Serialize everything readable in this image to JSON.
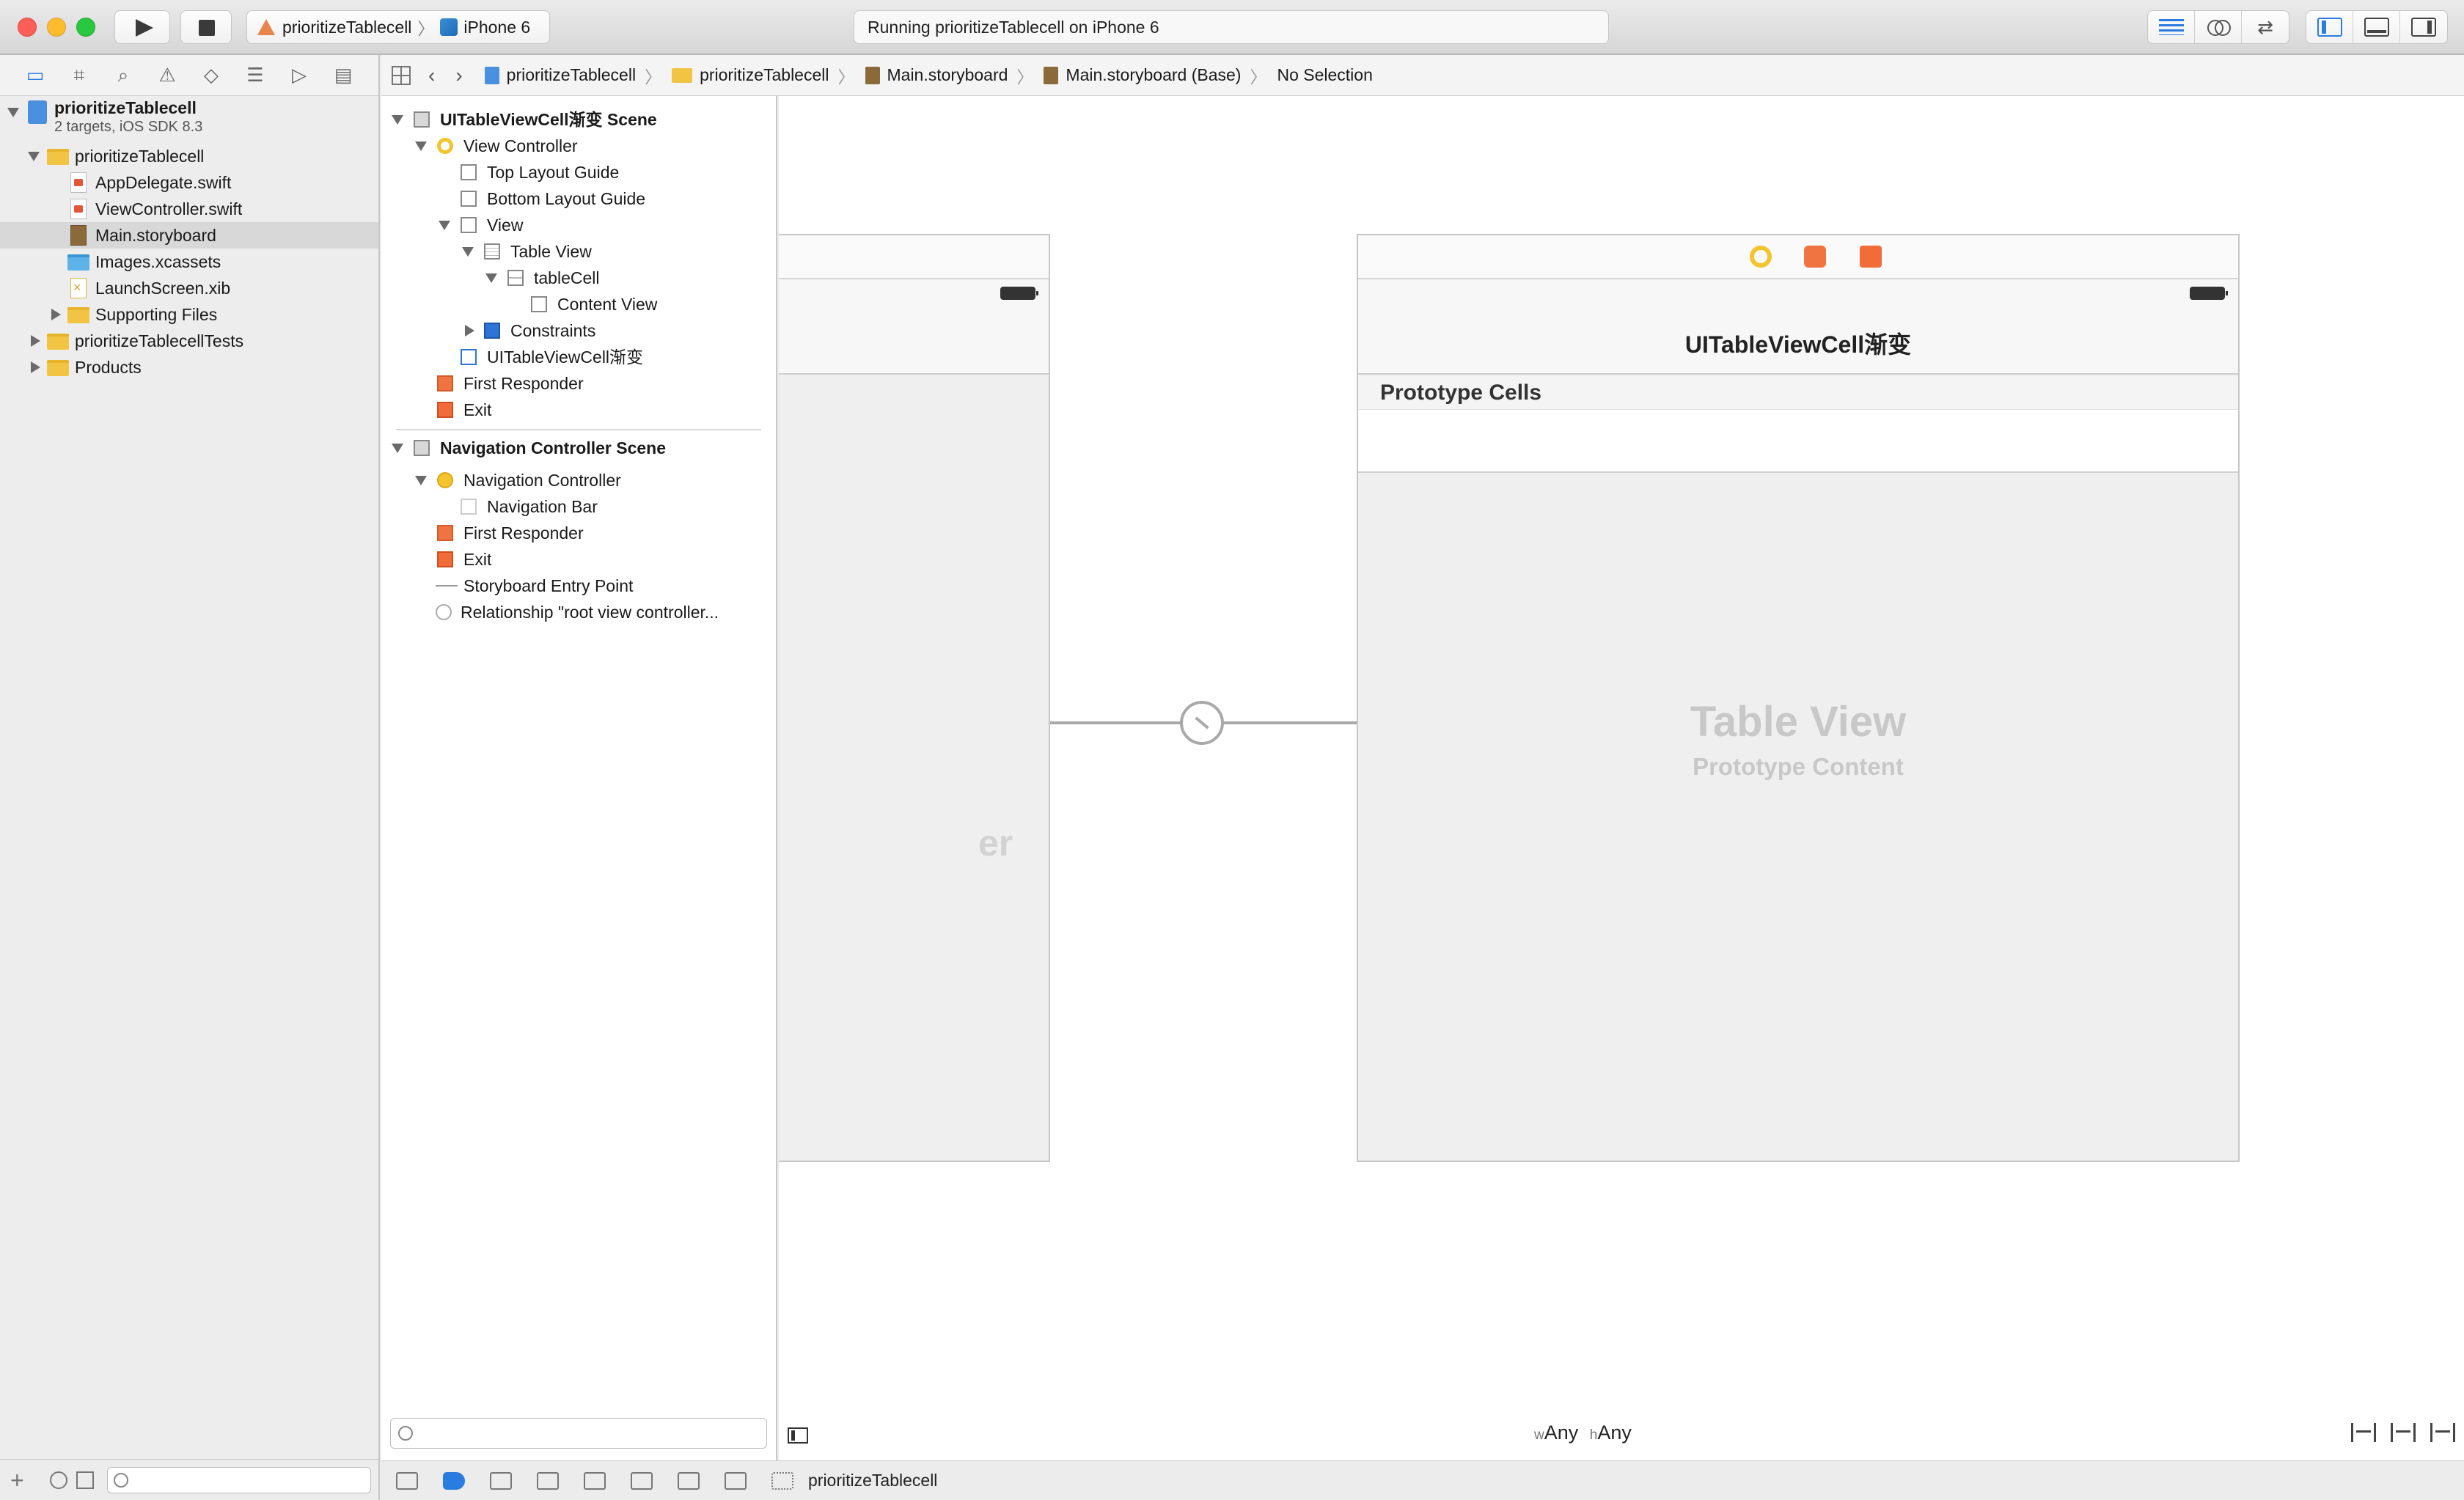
{
  "toolbar": {
    "scheme_target": "prioritizeTablecell",
    "device": "iPhone 6",
    "activity_status": "Running prioritizeTablecell on iPhone 6"
  },
  "navigator": {
    "project": {
      "name": "prioritizeTablecell",
      "subtitle": "2 targets, iOS SDK 8.3"
    },
    "items": [
      {
        "label": "prioritizeTablecell",
        "kind": "folder",
        "level": 1,
        "disclosure": "open"
      },
      {
        "label": "AppDelegate.swift",
        "kind": "swift",
        "level": 2
      },
      {
        "label": "ViewController.swift",
        "kind": "swift",
        "level": 2
      },
      {
        "label": "Main.storyboard",
        "kind": "storyboard",
        "level": 2,
        "selected": true
      },
      {
        "label": "Images.xcassets",
        "kind": "folder-blue",
        "level": 2
      },
      {
        "label": "LaunchScreen.xib",
        "kind": "xib",
        "level": 2
      },
      {
        "label": "Supporting Files",
        "kind": "folder",
        "level": 2,
        "disclosure": "closed"
      },
      {
        "label": "prioritizeTablecellTests",
        "kind": "folder",
        "level": 1,
        "disclosure": "closed"
      },
      {
        "label": "Products",
        "kind": "folder",
        "level": 1,
        "disclosure": "closed"
      }
    ]
  },
  "jumpbar": {
    "crumbs": [
      "prioritizeTablecell",
      "prioritizeTablecell",
      "Main.storyboard",
      "Main.storyboard (Base)",
      "No Selection"
    ]
  },
  "outline": {
    "scene1": {
      "title": "UITableViewCell渐变 Scene",
      "view_controller": "View Controller",
      "top_guide": "Top Layout Guide",
      "bottom_guide": "Bottom Layout Guide",
      "view": "View",
      "table_view": "Table View",
      "table_cell": "tableCell",
      "content_view": "Content View",
      "constraints": "Constraints",
      "nav_item": "UITableViewCell渐变",
      "first_responder": "First Responder",
      "exit": "Exit"
    },
    "scene2": {
      "title": "Navigation Controller Scene",
      "nav_controller": "Navigation Controller",
      "nav_bar": "Navigation Bar",
      "first_responder": "First Responder",
      "exit": "Exit",
      "entry_point": "Storyboard Entry Point",
      "relationship": "Relationship \"root view controller..."
    }
  },
  "canvas": {
    "left_ghost_text": "er",
    "right_nav_title": "UITableViewCell渐变",
    "prototype_cells": "Prototype Cells",
    "table_view_title": "Table View",
    "table_view_sub": "Prototype Content",
    "size_w_prefix": "w",
    "size_w": "Any",
    "size_h_prefix": "h",
    "size_h": "Any"
  },
  "debugbar": {
    "target": "prioritizeTablecell"
  },
  "colors": {
    "accent": "#2a7ce0",
    "vc_yellow": "#f3c42d",
    "responder_orange": "#ef7441",
    "exit_orange": "#f26c3a"
  }
}
